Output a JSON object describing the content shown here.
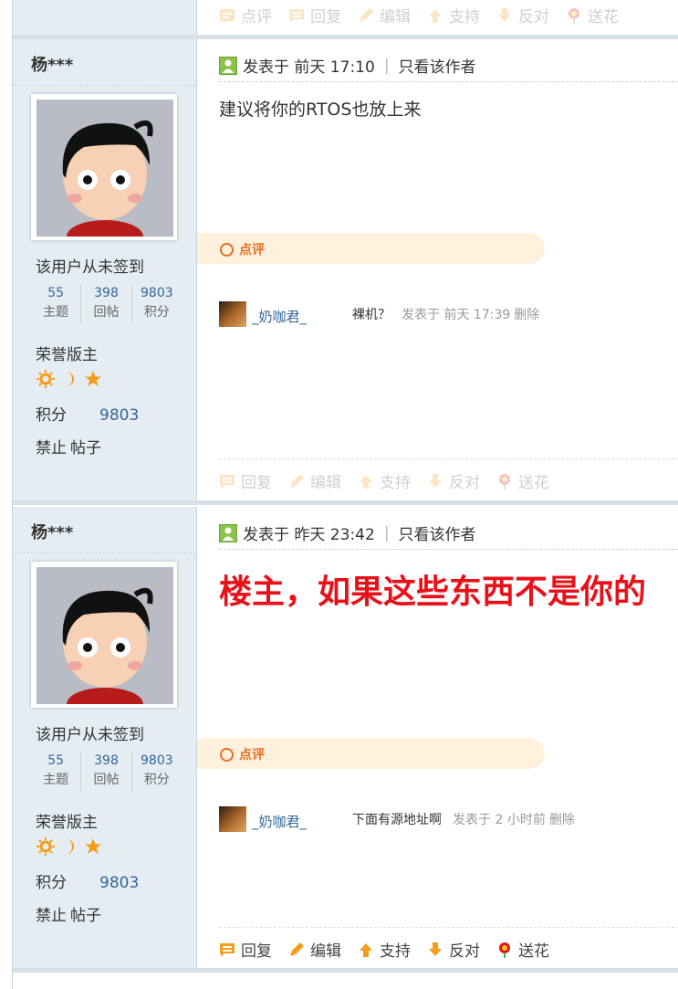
{
  "top_actions": [
    {
      "label": "点评",
      "icon": "comment-icon"
    },
    {
      "label": "回复",
      "icon": "reply-icon"
    },
    {
      "label": "编辑",
      "icon": "edit-icon"
    },
    {
      "label": "支持",
      "icon": "support-icon"
    },
    {
      "label": "反对",
      "icon": "oppose-icon"
    },
    {
      "label": "送花",
      "icon": "flower-icon"
    }
  ],
  "posts": [
    {
      "author": "杨***",
      "signin": "该用户从未签到",
      "stats": [
        {
          "num": "55",
          "label": "主题"
        },
        {
          "num": "398",
          "label": "回帖"
        },
        {
          "num": "9803",
          "label": "积分"
        }
      ],
      "rank": "荣誉版主",
      "points_label": "积分",
      "points_value": "9803",
      "ban": "禁止",
      "posts_link": "帖子",
      "posted": "发表于 前天 17:10",
      "only_author": "只看该作者",
      "message": "建议将你的RTOS也放上来",
      "rate_label": "点评",
      "comment": {
        "user": "_奶咖君_",
        "text": "裸机？",
        "time": "发表于 前天 17:39",
        "delete": "删除"
      },
      "actions": [
        {
          "label": "回复"
        },
        {
          "label": "编辑"
        },
        {
          "label": "支持"
        },
        {
          "label": "反对"
        },
        {
          "label": "送花"
        }
      ]
    },
    {
      "author": "杨***",
      "signin": "该用户从未签到",
      "stats": [
        {
          "num": "55",
          "label": "主题"
        },
        {
          "num": "398",
          "label": "回帖"
        },
        {
          "num": "9803",
          "label": "积分"
        }
      ],
      "rank": "荣誉版主",
      "points_label": "积分",
      "points_value": "9803",
      "ban": "禁止",
      "posts_link": "帖子",
      "posted": "发表于 昨天 23:42",
      "only_author": "只看该作者",
      "message": "楼主，如果这些东西不是你的",
      "rate_label": "点评",
      "comment": {
        "user": "_奶咖君_",
        "text": "下面有源地址啊",
        "time": "发表于 2 小时前",
        "delete": "删除"
      },
      "actions": [
        {
          "label": "回复"
        },
        {
          "label": "编辑"
        },
        {
          "label": "支持"
        },
        {
          "label": "反对"
        },
        {
          "label": "送花"
        }
      ]
    }
  ],
  "colors": {
    "sidebar": "#e5edf2",
    "link": "#336699",
    "red_text": "#e8111a",
    "rate_bg": "#fff1dc",
    "accent": "#f59c1a"
  }
}
